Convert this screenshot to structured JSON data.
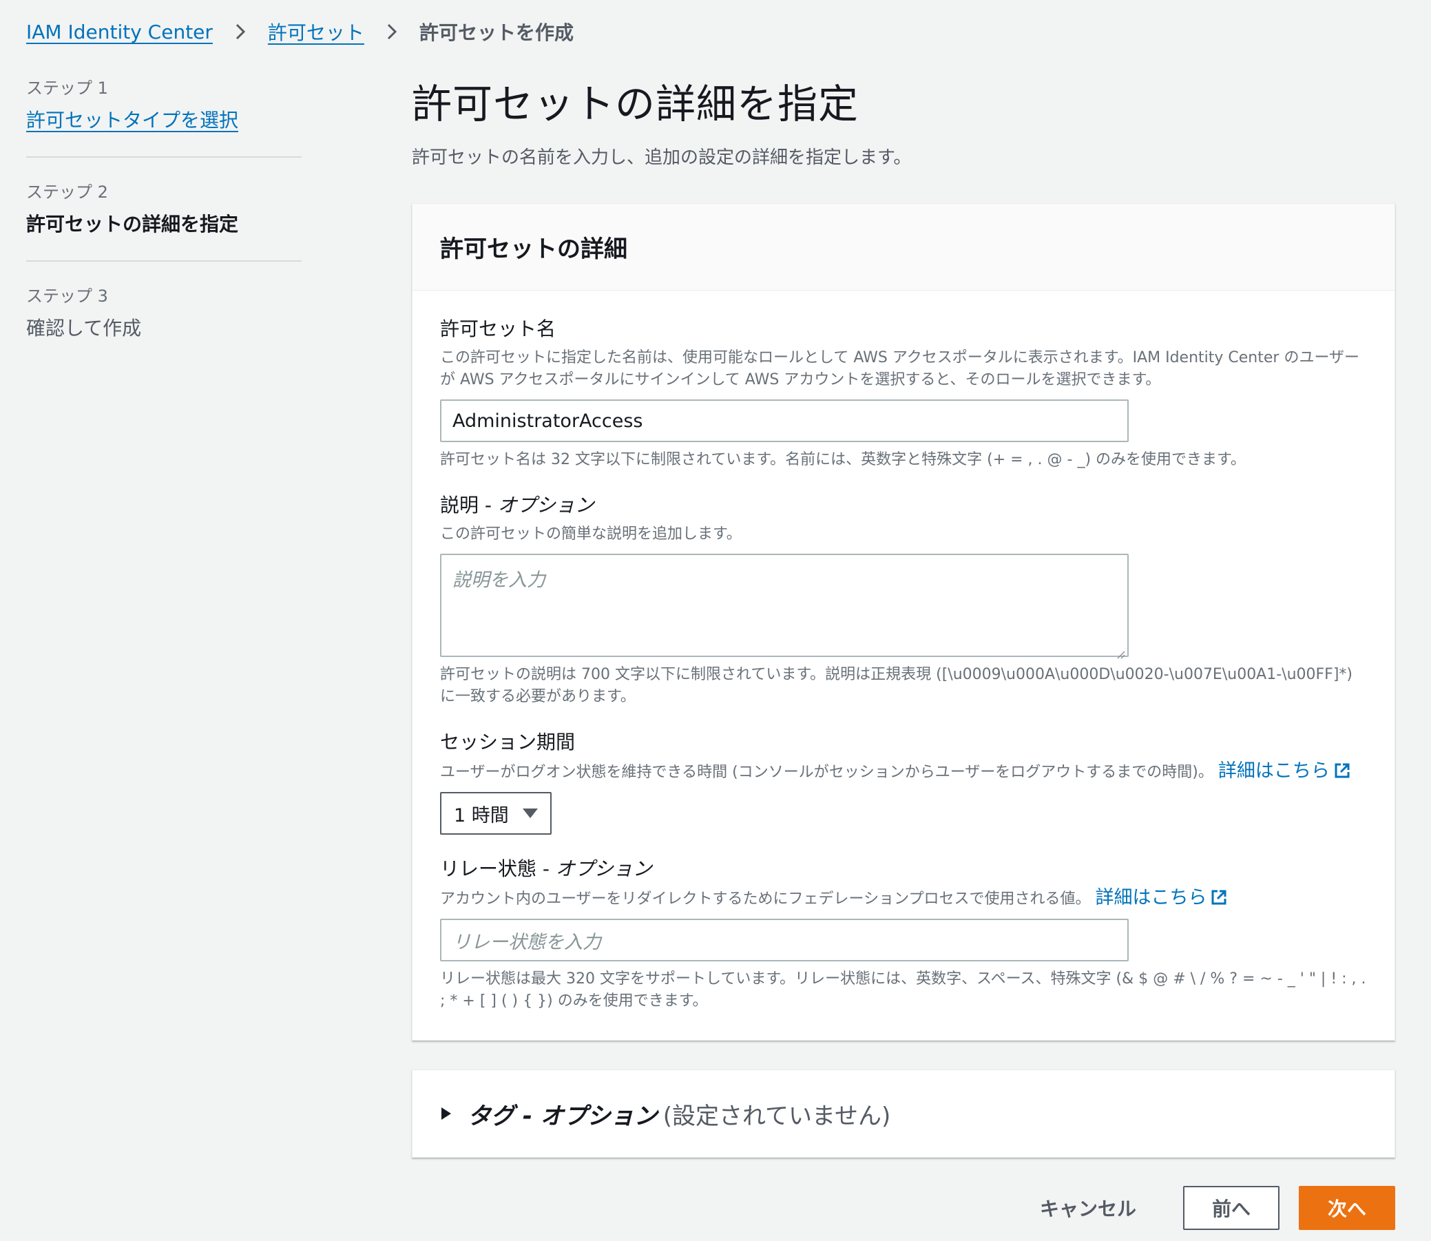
{
  "breadcrumb": {
    "root": "IAM Identity Center",
    "parent": "許可セット",
    "current": "許可セットを作成"
  },
  "steps": [
    {
      "number": "ステップ 1",
      "label": "許可セットタイプを選択"
    },
    {
      "number": "ステップ 2",
      "label": "許可セットの詳細を指定"
    },
    {
      "number": "ステップ 3",
      "label": "確認して作成"
    }
  ],
  "page": {
    "title": "許可セットの詳細を指定",
    "description": "許可セットの名前を入力し、追加の設定の詳細を指定します。"
  },
  "details_panel": {
    "header": "許可セットの詳細",
    "name": {
      "label": "許可セット名",
      "description": "この許可セットに指定した名前は、使用可能なロールとして AWS アクセスポータルに表示されます。IAM Identity Center のユーザーが AWS アクセスポータルにサインインして AWS アカウントを選択すると、そのロールを選択できます。",
      "value": "AdministratorAccess",
      "hint": "許可セット名は 32 文字以下に制限されています。名前には、英数字と特殊文字 (+ = , . @ - _) のみを使用できます。"
    },
    "description_field": {
      "label": "説明 - ",
      "optional": "オプション",
      "description": "この許可セットの簡単な説明を追加します。",
      "placeholder": "説明を入力",
      "hint": "許可セットの説明は 700 文字以下に制限されています。説明は正規表現 ([\\u0009\\u000A\\u000D\\u0020-\\u007E\\u00A1-\\u00FF]*) に一致する必要があります。"
    },
    "session": {
      "label": "セッション期間",
      "description": "ユーザーがログオン状態を維持できる時間 (コンソールがセッションからユーザーをログアウトするまでの時間)。",
      "link": "詳細はこちら",
      "selected": "1 時間"
    },
    "relay": {
      "label": "リレー状態 - ",
      "optional": "オプション",
      "description": "アカウント内のユーザーをリダイレクトするためにフェデレーションプロセスで使用される値。",
      "link": "詳細はこちら",
      "placeholder": "リレー状態を入力",
      "hint": "リレー状態は最大 320 文字をサポートしています。リレー状態には、英数字、スペース、特殊文字 (& $ @ # \\ / % ? = ~ - _ ' \" | ! : , . ; * + [ ] ( ) { }) のみを使用できます。"
    }
  },
  "tags_panel": {
    "title": "タグ - オプション",
    "status": "(設定されていません)"
  },
  "actions": {
    "cancel": "キャンセル",
    "previous": "前へ",
    "next": "次へ"
  },
  "colors": {
    "accent": "#ec7211",
    "link": "#0073bb",
    "background": "#f2f3f3"
  }
}
